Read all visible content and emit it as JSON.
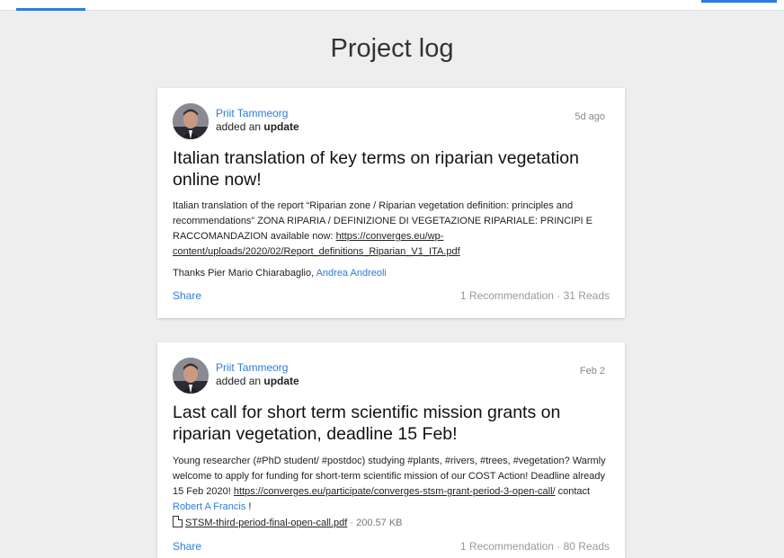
{
  "page": {
    "title": "Project log"
  },
  "posts": [
    {
      "author": "Priit Tammeorg",
      "action_prefix": "added an ",
      "action_type": "update",
      "time": "5d ago",
      "title": "Italian translation of key terms on riparian vegetation online now!",
      "body_text": "Italian translation of the report “Riparian zone / Riparian vegetation definition: principles and recommendations” ZONA RIPARIA / DEFINIZIONE DI VEGETAZIONE RIPARIALE: PRINCIPI E RACCOMANDAZION available now: ",
      "body_link": "https://converges.eu/wp-content/uploads/2020/02/Report_definitions_Riparian_V1_ITA.pdf",
      "thanks_text": "Thanks Pier Mario Chiarabaglio, ",
      "thanks_mention": "Andrea Andreoli",
      "share_label": "Share",
      "stats": "1 Recommendation · 31 Reads"
    },
    {
      "author": "Priit Tammeorg",
      "action_prefix": "added an ",
      "action_type": "update",
      "time": "Feb 2",
      "title": "Last call for short term scientific mission grants on riparian vegetation, deadline 15 Feb!",
      "body_text": "Young researcher (#PhD student/ #postdoc) studying #plants, #rivers, #trees, #vegetation? Warmly welcome to apply for funding for short-term scientific mission of our COST Action! Deadline already 15 Feb 2020! ",
      "body_link": "https://converges.eu/participate/converges-stsm-grant-period-3-open-call/",
      "body_after_link": " contact ",
      "body_mention": "Robert A Francis",
      "body_end": " !",
      "attachment_name": "STSM-third-period-final-open-call.pdf",
      "attachment_size": " · 200.57 KB",
      "share_label": "Share",
      "stats": "1 Recommendation · 80 Reads"
    }
  ],
  "colors": {
    "accent": "#2c7be5",
    "background": "#eeeeee",
    "card": "#ffffff"
  }
}
